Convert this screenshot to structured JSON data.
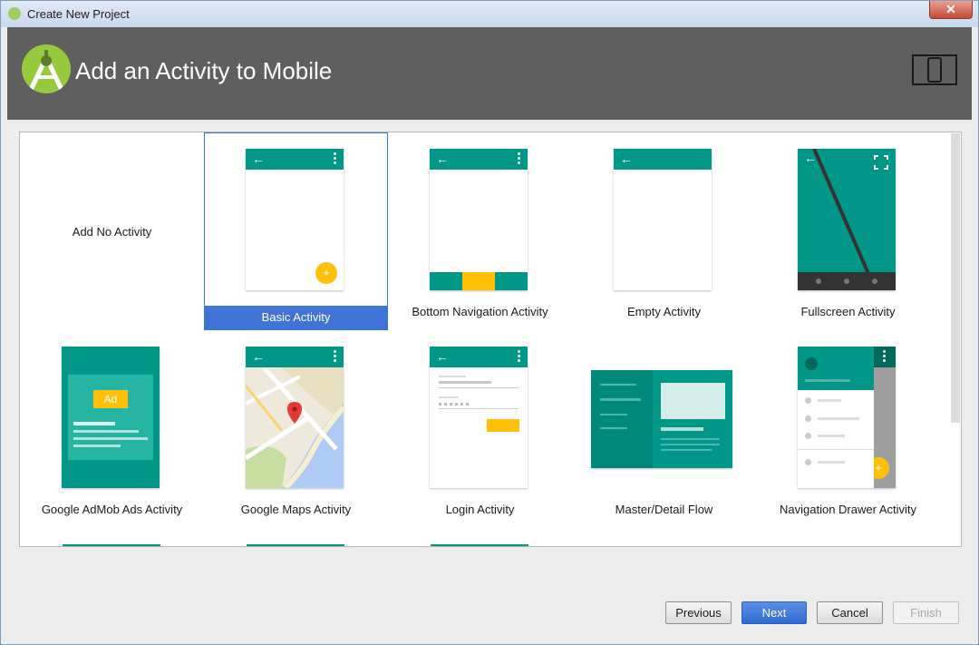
{
  "window": {
    "title": "Create New Project",
    "close_label": "✕"
  },
  "header": {
    "title": "Add an Activity to Mobile"
  },
  "tiles": [
    {
      "label": "Add No Activity"
    },
    {
      "label": "Basic Activity",
      "selected": true
    },
    {
      "label": "Bottom Navigation Activity"
    },
    {
      "label": "Empty Activity"
    },
    {
      "label": "Fullscreen Activity"
    },
    {
      "label": "Google AdMob Ads Activity",
      "ad_badge": "Ad"
    },
    {
      "label": "Google Maps Activity"
    },
    {
      "label": "Login Activity"
    },
    {
      "label": "Master/Detail Flow"
    },
    {
      "label": "Navigation Drawer Activity"
    }
  ],
  "buttons": {
    "previous": "Previous",
    "next": "Next",
    "cancel": "Cancel",
    "finish": "Finish"
  },
  "colors": {
    "accent": "#009688",
    "fab": "#ffc107",
    "selection": "#3f73d6",
    "header_bg": "#5f5f5f"
  }
}
